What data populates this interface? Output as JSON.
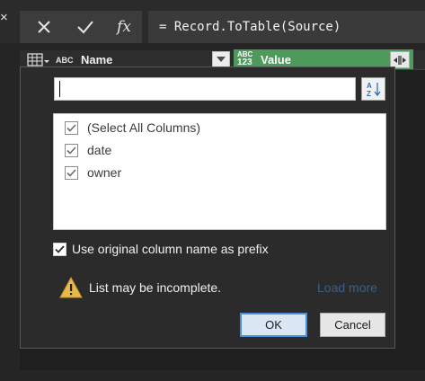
{
  "formula_bar": {
    "close_glyph": "×",
    "cancel_icon": "x-icon",
    "commit_icon": "check-icon",
    "fx_label": "fx",
    "formula": "= Record.ToTable(Source)"
  },
  "columns": [
    {
      "type_label": "ABC",
      "name": "Name"
    },
    {
      "type_label_top": "ABC",
      "type_label_bottom": "123",
      "name": "Value"
    }
  ],
  "expand_popup": {
    "search": {
      "value": "",
      "placeholder": ""
    },
    "items": [
      {
        "label": "(Select All Columns)",
        "checked": true
      },
      {
        "label": "date",
        "checked": true
      },
      {
        "label": "owner",
        "checked": true
      }
    ],
    "prefix_option": {
      "label": "Use original column name as prefix",
      "checked": true
    },
    "warning": "List may be incomplete.",
    "load_more": "Load more",
    "ok_label": "OK",
    "cancel_label": "Cancel"
  },
  "colors": {
    "value_header": "#4e9a5d",
    "ok_border": "#4a90d9",
    "link": "#3e5f83",
    "warning": "#e8b84a"
  }
}
